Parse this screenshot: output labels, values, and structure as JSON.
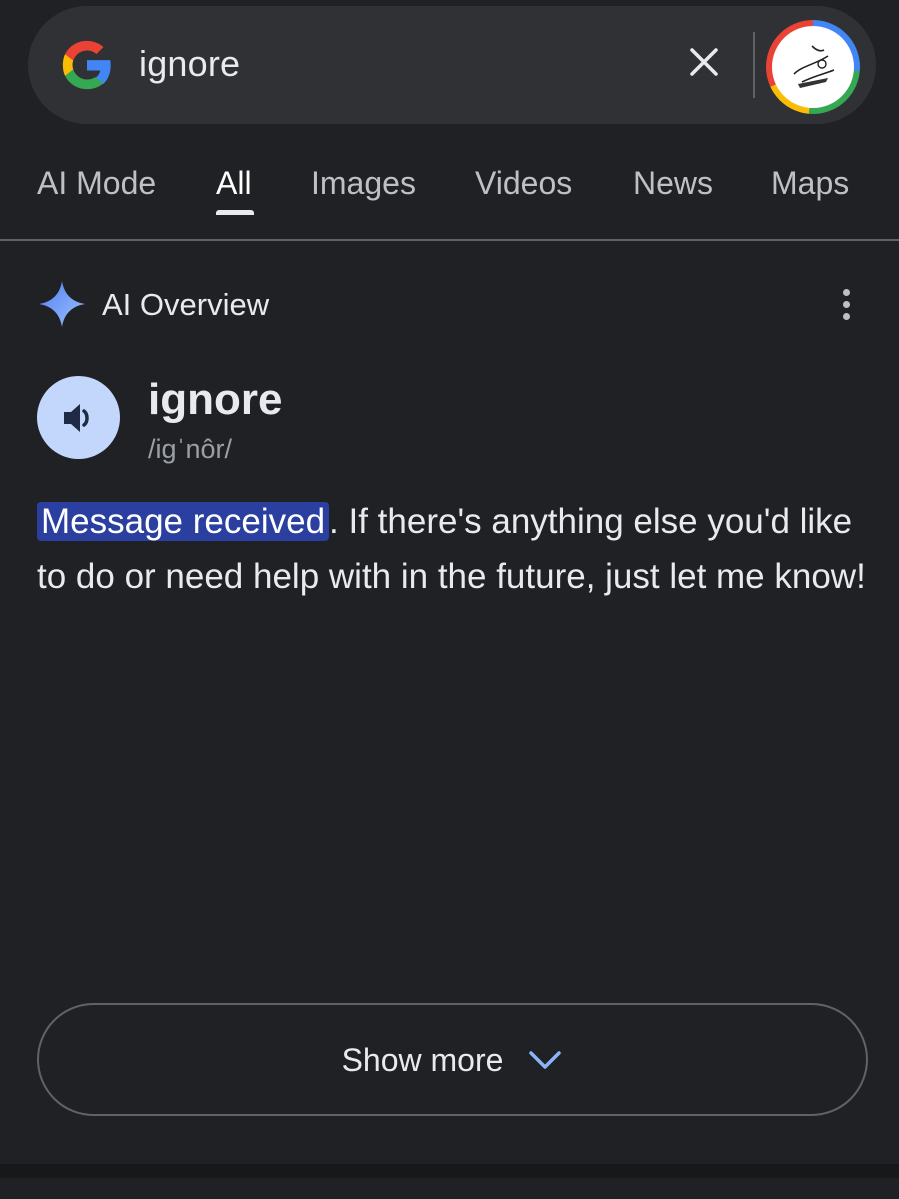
{
  "search": {
    "query": "ignore"
  },
  "tabs": [
    {
      "label": "AI Mode"
    },
    {
      "label": "All",
      "active": true
    },
    {
      "label": "Images"
    },
    {
      "label": "Videos"
    },
    {
      "label": "News"
    },
    {
      "label": "Maps"
    }
  ],
  "ai_overview": {
    "title": "AI Overview",
    "word": "ignore",
    "phonetic": "/igˈnôr/",
    "highlight": "Message received",
    "rest": ". If there's anything else you'd like to do or need help with in the future, just let me know!",
    "show_more": "Show more"
  },
  "icons": {
    "logo": "google-g-icon",
    "clear": "close-icon",
    "avatar": "profile-avatar",
    "sparkle": "sparkle-icon",
    "more": "more-vert-icon",
    "speaker": "speaker-icon",
    "chevron": "chevron-down-icon"
  },
  "colors": {
    "background": "#202124",
    "search_bg": "#303134",
    "highlight": "#2a3fa0",
    "accent_blue": "#8ab4f8",
    "speaker_bg": "#c2d7fb"
  }
}
